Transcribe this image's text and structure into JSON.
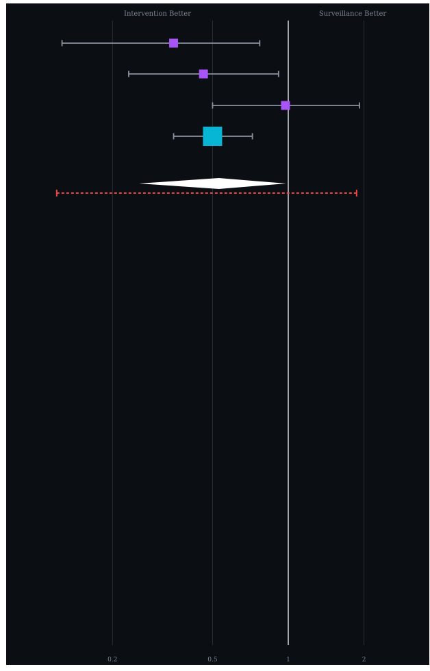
{
  "colors": {
    "background": "#0b0e13",
    "page": "#ffffff",
    "grid": "#2a313b",
    "null_line": "#c8cdd2",
    "whisker": "#8a93a0",
    "study_marker": "#a855f7",
    "pooled_marker": "#06b6d4",
    "summary_diamond": "#ffffff",
    "prediction_interval": "#ef4444",
    "label_text": "#7b8594"
  },
  "chart_data": {
    "type": "scatter",
    "subtype": "forest-plot",
    "scale": "log",
    "xlim": [
      0.09,
      2.9
    ],
    "null_value": 1,
    "direction_labels": {
      "left": "Intervention Better",
      "right": "Surveillance Better"
    },
    "x_ticks": [
      {
        "value": 0.2,
        "label": "0.2"
      },
      {
        "value": 0.5,
        "label": "0.5"
      },
      {
        "value": 1,
        "label": "1"
      },
      {
        "value": 2,
        "label": "2"
      }
    ],
    "studies": [
      {
        "estimate": 0.35,
        "lower": 0.126,
        "upper": 0.77,
        "weight": "small"
      },
      {
        "estimate": 0.46,
        "lower": 0.232,
        "upper": 0.915,
        "weight": "small"
      },
      {
        "estimate": 0.975,
        "lower": 0.5,
        "upper": 1.92,
        "weight": "small"
      },
      {
        "estimate": 0.5,
        "lower": 0.35,
        "upper": 0.72,
        "weight": "large"
      }
    ],
    "summary": {
      "estimate": 0.53,
      "lower": 0.255,
      "upper": 0.98
    },
    "prediction_interval": {
      "lower": 0.12,
      "upper": 1.87
    }
  }
}
